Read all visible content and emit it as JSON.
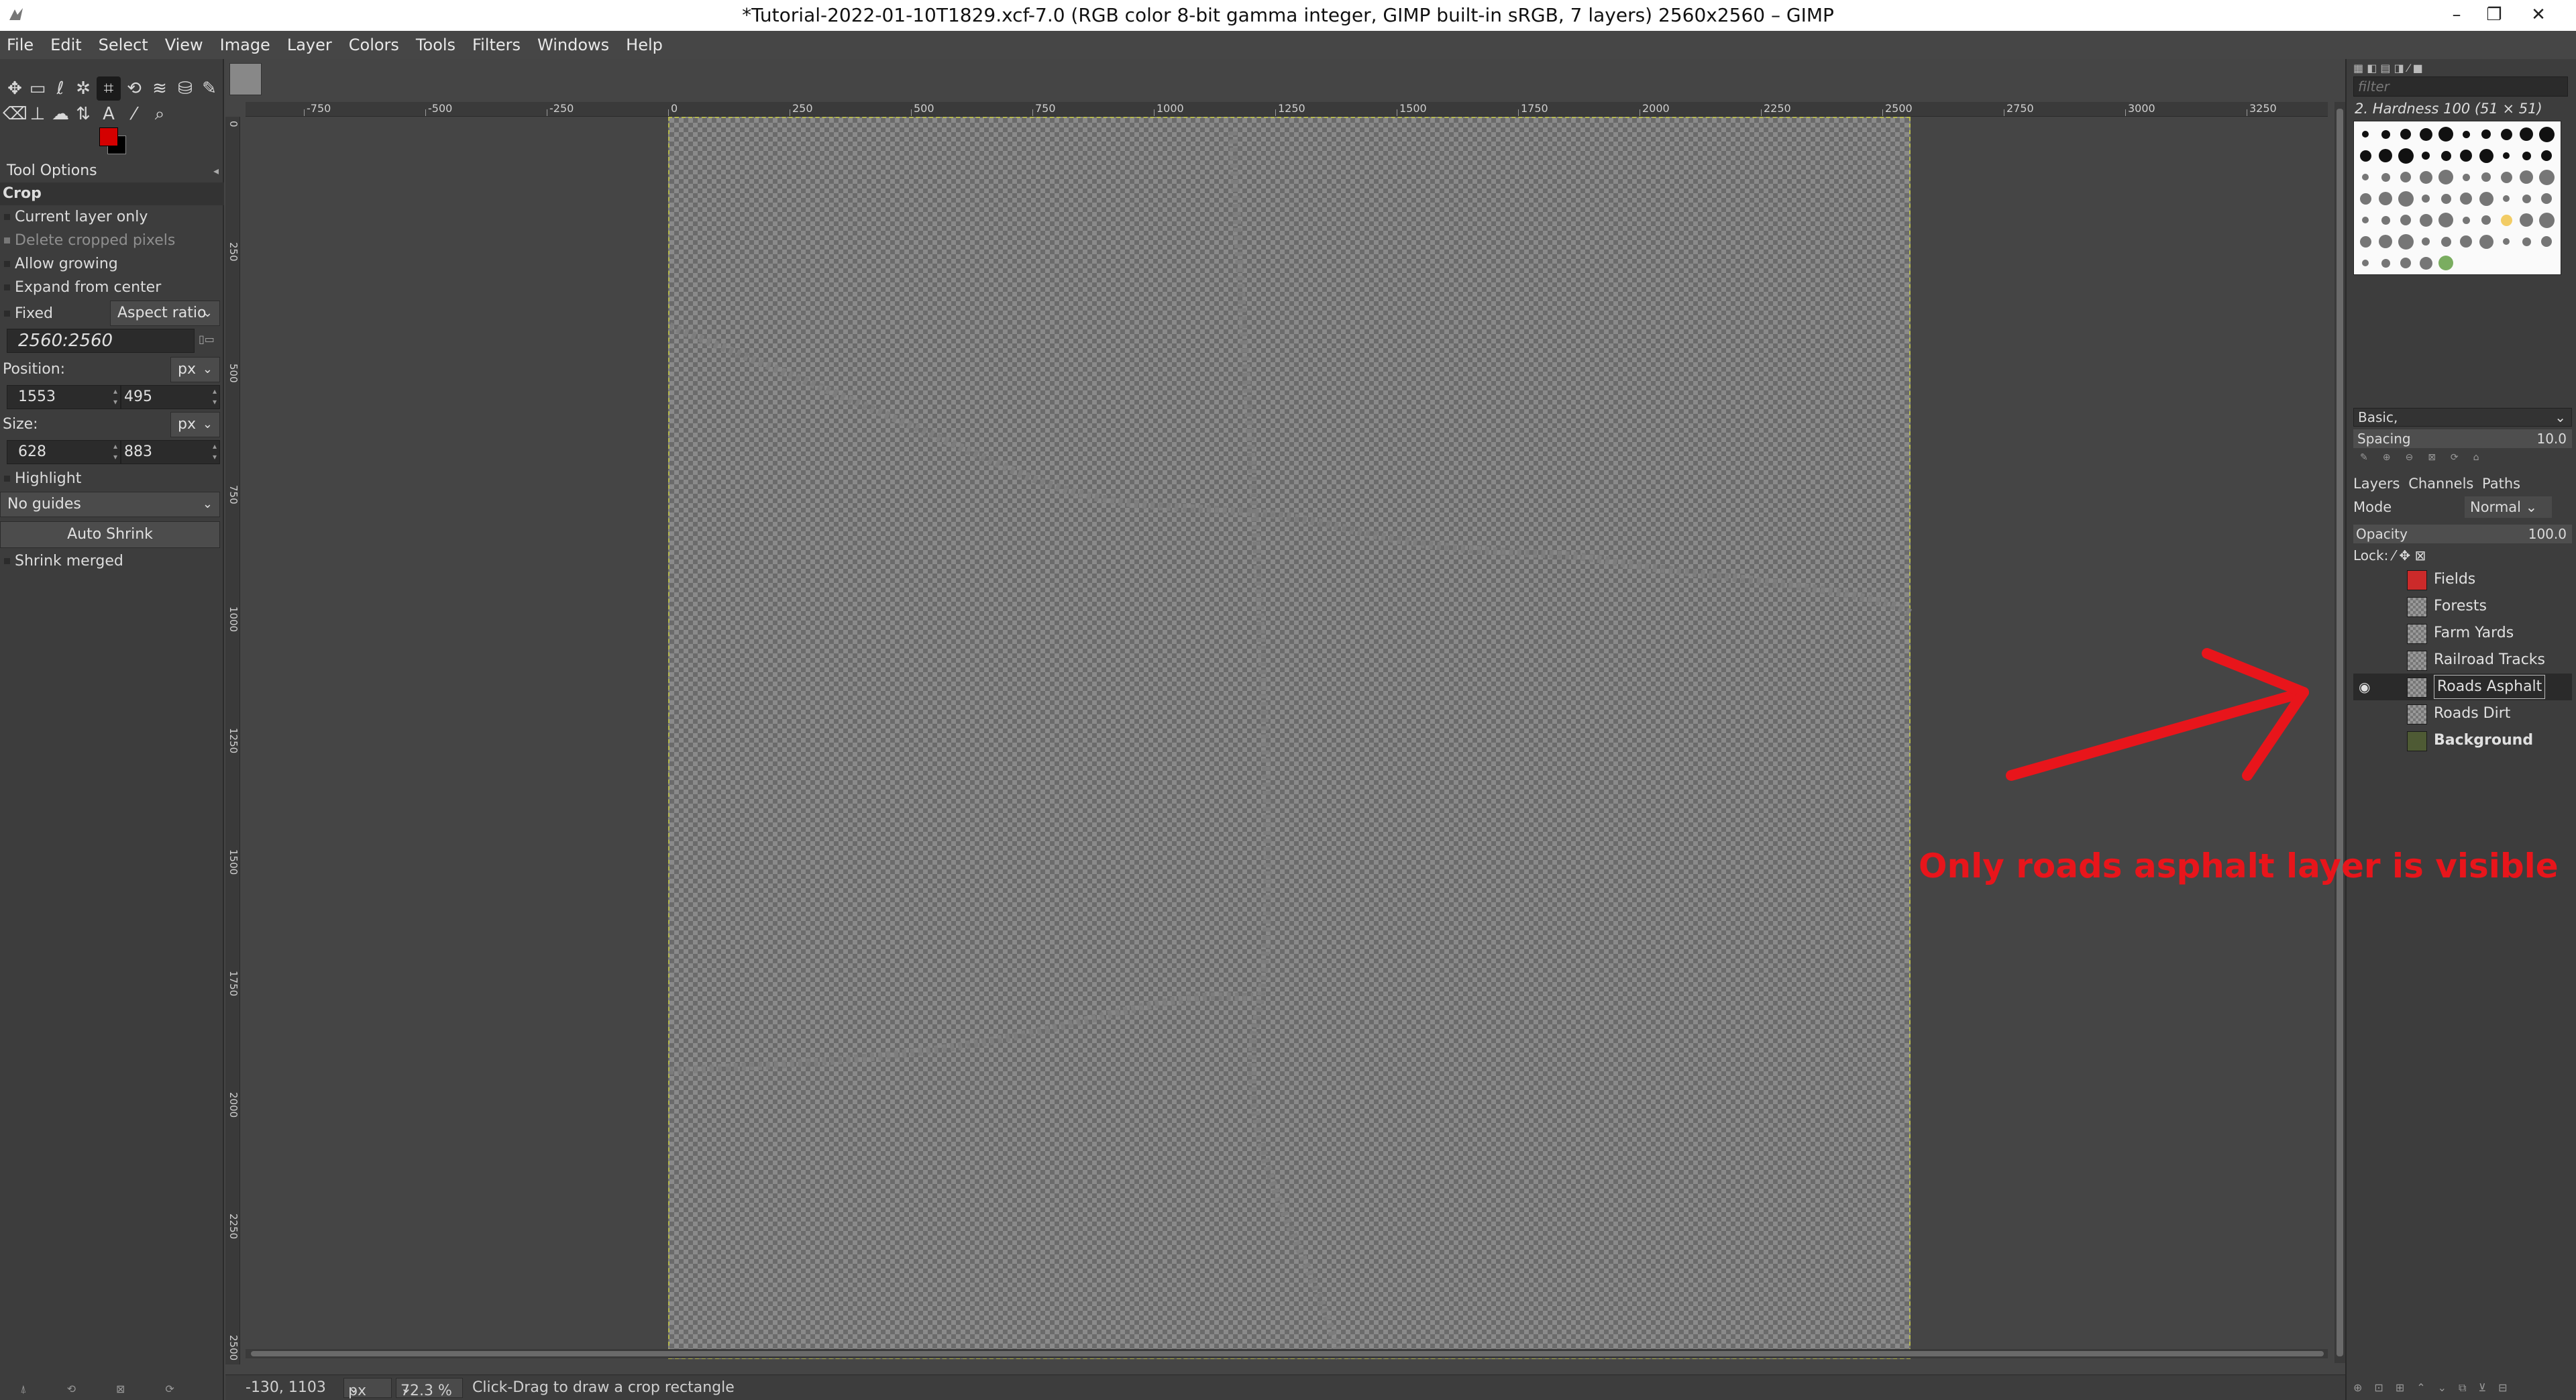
{
  "window": {
    "title": "*Tutorial-2022-01-10T1829.xcf-7.0 (RGB color 8-bit gamma integer, GIMP built-in sRGB, 7 layers) 2560x2560 – GIMP",
    "minimize_glyph": "–",
    "maximize_glyph": "❐",
    "close_glyph": "✕"
  },
  "menu": [
    "File",
    "Edit",
    "Select",
    "View",
    "Image",
    "Layer",
    "Colors",
    "Tools",
    "Filters",
    "Windows",
    "Help"
  ],
  "tool_options": {
    "panel_title": "Tool Options",
    "tool_name": "Crop",
    "current_layer_only": "Current layer only",
    "delete_cropped_pixels": "Delete cropped pixels",
    "allow_growing": "Allow growing",
    "expand_from_center": "Expand from center",
    "fixed_label": "Fixed",
    "fixed_mode": "Aspect ratio",
    "ratio_value": "2560:2560",
    "position_label": "Position:",
    "position_unit": "px",
    "position_x": "1553",
    "position_y": "495",
    "size_label": "Size:",
    "size_unit": "px",
    "size_w": "628",
    "size_h": "883",
    "highlight": "Highlight",
    "guides": "No guides",
    "auto_shrink": "Auto Shrink",
    "shrink_merged": "Shrink merged"
  },
  "ruler": {
    "h_labels": [
      "-750",
      "-500",
      "-250",
      "0",
      "250",
      "500",
      "750",
      "1000",
      "1250",
      "1500",
      "1750",
      "2000",
      "2250",
      "2500",
      "2750",
      "3000",
      "3250"
    ],
    "v_labels": [
      "0",
      "250",
      "500",
      "750",
      "1000",
      "1250",
      "1500",
      "1750",
      "2000",
      "2250",
      "2500"
    ]
  },
  "status": {
    "coords": "-130, 1103",
    "unit": "px",
    "zoom": "72.3 %",
    "message": "Click-Drag to draw a crop rectangle"
  },
  "brushes": {
    "filter_placeholder": "filter",
    "selected_brush": "2. Hardness 100 (51 × 51)",
    "preset": "Basic,",
    "spacing_label": "Spacing",
    "spacing_value": "10.0"
  },
  "layers_panel": {
    "tabs": [
      "Layers",
      "Channels",
      "Paths"
    ],
    "mode_label": "Mode",
    "mode_value": "Normal",
    "opacity_label": "Opacity",
    "opacity_value": "100.0",
    "lock_label": "Lock:",
    "layers": [
      {
        "name": "Fields",
        "visible": false,
        "thumb": "red"
      },
      {
        "name": "Forests",
        "visible": false,
        "thumb": "checker"
      },
      {
        "name": "Farm Yards",
        "visible": false,
        "thumb": "checker"
      },
      {
        "name": "Railroad Tracks",
        "visible": false,
        "thumb": "checker"
      },
      {
        "name": "Roads Asphalt",
        "visible": true,
        "thumb": "checker",
        "active": true
      },
      {
        "name": "Roads Dirt",
        "visible": false,
        "thumb": "checker"
      },
      {
        "name": "Background",
        "visible": false,
        "thumb": "olive",
        "bold": true
      }
    ]
  },
  "annotation": {
    "text": "Only roads asphalt layer is visible",
    "color": "#e8151b"
  }
}
